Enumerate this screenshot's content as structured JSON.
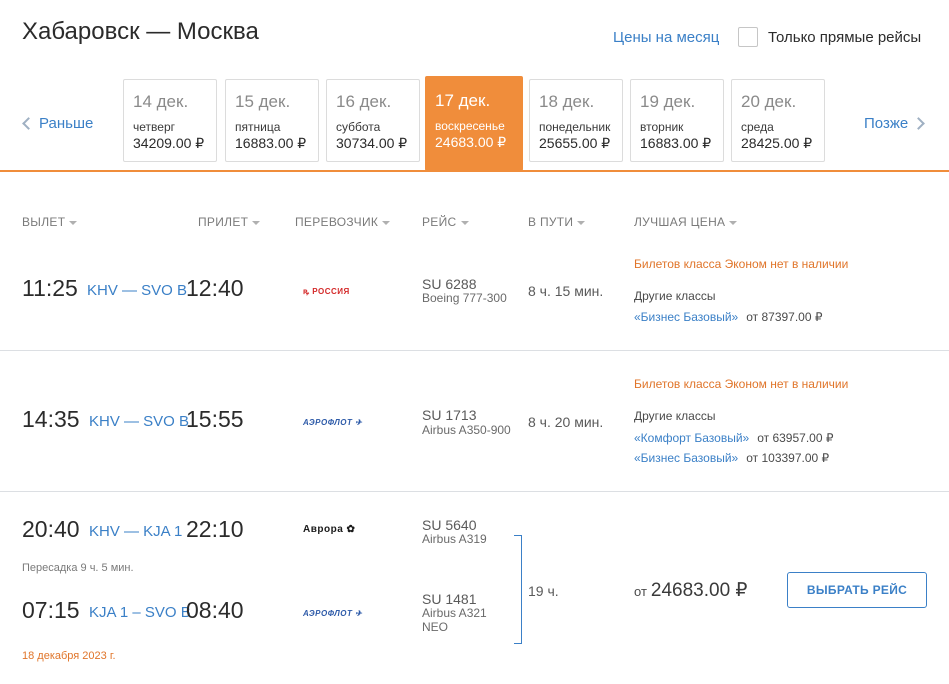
{
  "header": {
    "route": "Хабаровск — Москва",
    "month_prices": "Цены на месяц",
    "direct_only": "Только прямые рейсы"
  },
  "date_nav": {
    "prev": "Раньше",
    "next": "Позже",
    "dates": [
      {
        "date": "14 дек.",
        "weekday": "четверг",
        "price": "34209.00 ₽"
      },
      {
        "date": "15 дек.",
        "weekday": "пятница",
        "price": "16883.00 ₽"
      },
      {
        "date": "16 дек.",
        "weekday": "суббота",
        "price": "30734.00 ₽"
      },
      {
        "date": "17 дек.",
        "weekday": "воскресенье",
        "price": "24683.00 ₽"
      },
      {
        "date": "18 дек.",
        "weekday": "понедельник",
        "price": "25655.00 ₽"
      },
      {
        "date": "19 дек.",
        "weekday": "вторник",
        "price": "16883.00 ₽"
      },
      {
        "date": "20 дек.",
        "weekday": "среда",
        "price": "28425.00 ₽"
      }
    ]
  },
  "columns": {
    "departure": "ВЫЛЕТ",
    "arrival": "ПРИЛЕТ",
    "carrier": "ПЕРЕВОЗЧИК",
    "flight": "РЕЙС",
    "duration": "В ПУТИ",
    "best_price": "ЛУЧШАЯ ЦЕНА"
  },
  "flights": [
    {
      "dep_time": "11:25",
      "airports": "KHV — SVO B",
      "arr_time": "12:40",
      "carrier_logo": "РОССИЯ",
      "flight_no": "SU 6288",
      "aircraft": "Boeing 777-300",
      "duration": "8 ч. 15 мин.",
      "no_economy": "Билетов класса Эконом нет в наличии",
      "other_classes": "Другие классы",
      "fares": [
        {
          "name": "«Бизнес Базовый»",
          "price": "от 87397.00 ₽"
        }
      ]
    },
    {
      "dep_time": "14:35",
      "airports": "KHV — SVO B",
      "arr_time": "15:55",
      "carrier_logo": "АЭРОФЛОТ",
      "flight_no": "SU 1713",
      "aircraft": "Airbus A350-900",
      "duration": "8 ч. 20 мин.",
      "no_economy": "Билетов класса Эконом нет в наличии",
      "other_classes": "Другие классы",
      "fares": [
        {
          "name": "«Комфорт Базовый»",
          "price": "от 63957.00 ₽"
        },
        {
          "name": "«Бизнес Базовый»",
          "price": "от 103397.00 ₽"
        }
      ]
    }
  ],
  "connecting": {
    "leg1": {
      "dep_time": "20:40",
      "airports": "KHV — KJA 1",
      "arr_time": "22:10",
      "carrier_logo": "Аврора",
      "flight_no": "SU 5640",
      "aircraft": "Airbus A319"
    },
    "transfer": "Пересадка 9 ч. 5 мин.",
    "leg2": {
      "dep_time": "07:15",
      "airports": "KJA 1 – SVO B",
      "arr_time": "08:40",
      "carrier_logo": "АЭРОФЛОТ",
      "flight_no": "SU 1481",
      "aircraft_line1": "Airbus A321",
      "aircraft_line2": "NEO"
    },
    "arrival_date": "18 декабря 2023 г.",
    "duration": "19 ч.",
    "price_prefix": "от",
    "price": "24683.00 ₽",
    "select_label": "ВЫБРАТЬ РЕЙС"
  },
  "colors": {
    "accent": "#f08d3b",
    "link": "#3b80c7",
    "warning": "#e0752a"
  }
}
